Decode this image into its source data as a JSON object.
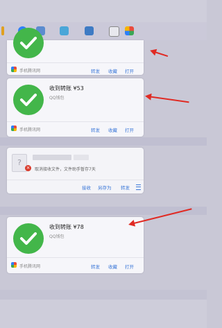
{
  "cards": [
    {
      "id": "card-1",
      "title": "",
      "subtitle": "",
      "source": "手机腾讯网",
      "actions": [
        "转发",
        "收藏",
        "打开"
      ]
    },
    {
      "id": "card-2",
      "title": "收到转账 ¥53",
      "subtitle": "QQ钱包",
      "source": "手机腾讯网",
      "actions": [
        "转发",
        "收藏",
        "打开"
      ]
    },
    {
      "id": "card-4",
      "title": "收到转账 ¥78",
      "subtitle": "QQ钱包",
      "source": "手机腾讯网",
      "actions": [
        "转发",
        "收藏",
        "打开"
      ]
    }
  ],
  "file_card": {
    "status": "取消接收文件，文件助手暂存7天",
    "file_icon": "?",
    "actions": [
      "接收",
      "另存为",
      "转发"
    ]
  },
  "colors": {
    "accent": "#3c78d8",
    "success": "#43b64a",
    "arrow": "#e02a23",
    "background": "#c9c8d6"
  },
  "icons": [
    "check-icon",
    "error-icon",
    "menu-icon",
    "tencent-news-icon",
    "file-unknown-icon"
  ]
}
